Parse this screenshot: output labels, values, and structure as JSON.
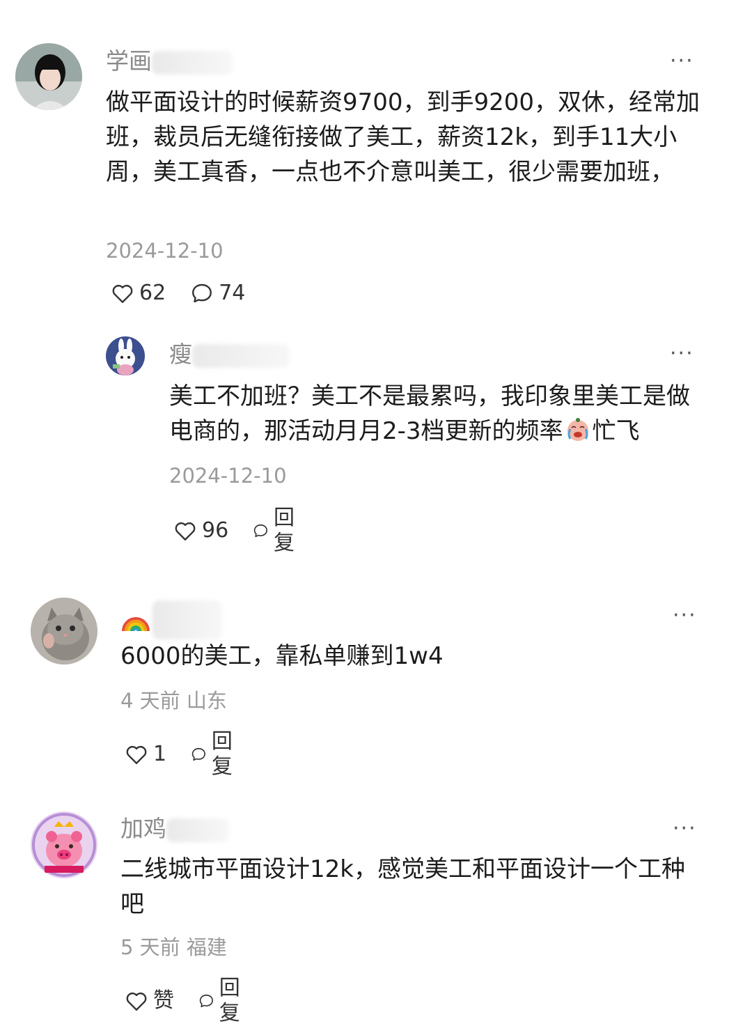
{
  "comments": [
    {
      "username_visible": "学画",
      "text": "做平面设计的时候薪资9700，到手9200，双休，经常加班，裁员后无缝衔接做了美工，薪资12k，到手11大小周，美工真香，一点也不介意叫美工，很少需要加班，",
      "meta": "2024-12-10",
      "likes": "62",
      "replies": "74",
      "reply": {
        "username_visible": "瘦",
        "text_before_emoji": "美工不加班？美工不是最累吗，我印象里美工是做电商的，那活动月月2-3档更新的频率",
        "text_after_emoji": "忙飞",
        "meta": "2024-12-10",
        "likes": "96",
        "reply_label": "回复"
      }
    },
    {
      "username_visible": "",
      "text": "6000的美工，靠私单赚到1w4",
      "meta": "4 天前 山东",
      "likes": "1",
      "reply_label": "回复"
    },
    {
      "username_visible": "加鸡",
      "text": "二线城市平面设计12k，感觉美工和平面设计一个工种吧",
      "meta": "5 天前 福建",
      "like_label": "赞",
      "reply_label": "回复"
    }
  ],
  "more_label": "···",
  "icons": [
    "heart-icon",
    "comment-bubble-icon",
    "more-icon",
    "rainbow-emoji-icon",
    "crying-emoji-icon"
  ]
}
